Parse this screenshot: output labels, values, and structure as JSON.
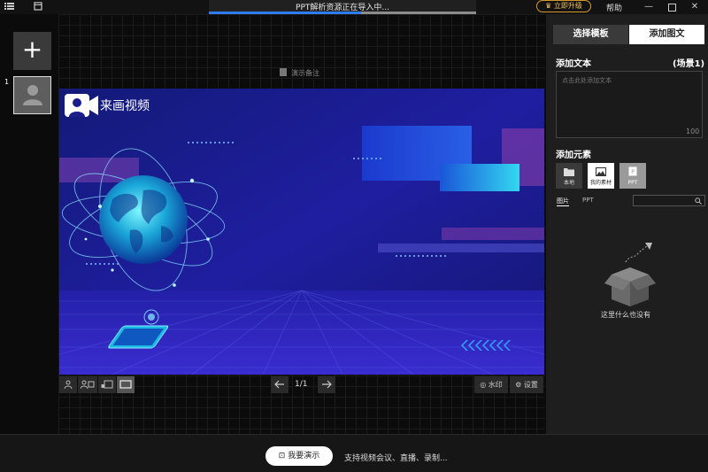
{
  "titlebar": {
    "import_status": "PPT解析资源正在导入中...",
    "import_progress_percent": 57,
    "upgrade_label": "立即升级",
    "help_label": "帮助"
  },
  "slides": {
    "add_symbol": "+",
    "items": [
      {
        "number": "1"
      }
    ]
  },
  "stage": {
    "notes_label": "演示备注",
    "slide_logo_text": "来画视频",
    "page_indicator": "1/1",
    "watermark_label": "水印",
    "settings_label": "设置"
  },
  "right_panel": {
    "tabs": [
      {
        "label": "选择模板",
        "active": false
      },
      {
        "label": "添加图文",
        "active": true
      }
    ],
    "add_text_label": "添加文本",
    "scene_label": "(场景1)",
    "text_placeholder": "点击此处添加文本",
    "char_limit": "100",
    "add_elements_label": "添加元素",
    "element_buttons": [
      {
        "label": "本地"
      },
      {
        "label": "我的素材"
      },
      {
        "label": "PPT"
      }
    ],
    "sub_tabs": [
      {
        "label": "图片",
        "active": true
      },
      {
        "label": "PPT",
        "active": false
      }
    ],
    "empty_text": "这里什么也没有"
  },
  "footer": {
    "present_label": "我要演示",
    "support_text": "支持视频会议、直播、录制..."
  },
  "colors": {
    "accent_blue": "#2e7cf0",
    "upgrade_gold": "#d69a2c",
    "slide_bg": "#1b1d8a"
  }
}
